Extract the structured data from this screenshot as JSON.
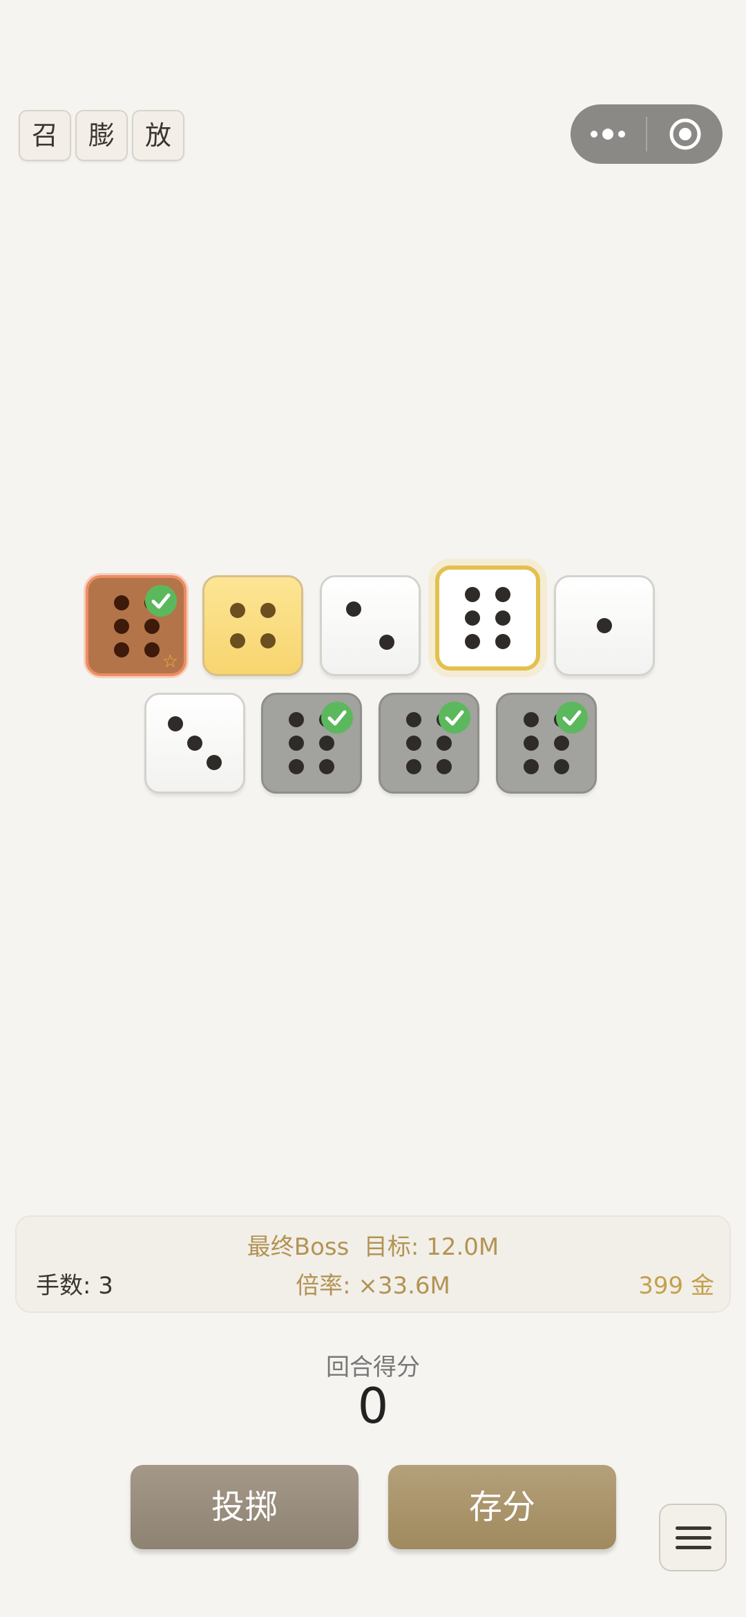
{
  "top_tags": [
    "召",
    "膨",
    "放"
  ],
  "capsule": {
    "more_icon": "more-dots-icon",
    "close_icon": "target-circle-icon"
  },
  "dice": [
    {
      "row": 1,
      "style": "brown",
      "face": 6,
      "checked": true,
      "star": true
    },
    {
      "row": 1,
      "style": "gold",
      "face": 4,
      "checked": false
    },
    {
      "row": 1,
      "style": "white",
      "face": 2,
      "checked": false
    },
    {
      "row": 1,
      "style": "selected",
      "face": 6,
      "checked": false
    },
    {
      "row": 1,
      "style": "white",
      "face": 1,
      "checked": false
    },
    {
      "row": 2,
      "style": "white",
      "face": 3,
      "checked": false
    },
    {
      "row": 2,
      "style": "gray",
      "face": 6,
      "checked": true
    },
    {
      "row": 2,
      "style": "gray",
      "face": 6,
      "checked": true
    },
    {
      "row": 2,
      "style": "gray",
      "face": 6,
      "checked": true
    }
  ],
  "info": {
    "goal": "最终Boss  目标: 12.0M",
    "hands": "手数: 3",
    "multiplier": "倍率: ×33.6M",
    "gold": "399 金"
  },
  "round": {
    "label": "回合得分",
    "score": "0"
  },
  "buttons": {
    "roll": "投掷",
    "save": "存分"
  },
  "menu_icon": "hamburger-menu-icon",
  "colors": {
    "background": "#f6f4f0",
    "accent_gold": "#b39354",
    "check_green": "#5cb85c",
    "selected_border": "#e3c04f"
  }
}
